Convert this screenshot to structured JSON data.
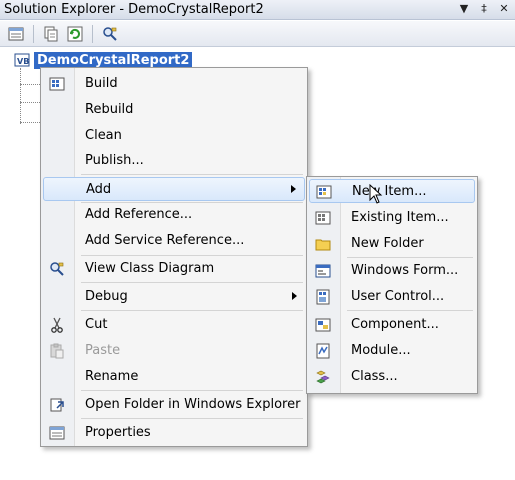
{
  "window": {
    "title": "Solution Explorer - DemoCrystalReport2",
    "buttons": [
      "▼",
      "‡",
      "✕"
    ]
  },
  "toolbar": {
    "icons": [
      "properties-icon",
      "show-all-files-icon",
      "refresh-icon",
      "view-class-diagram-icon"
    ]
  },
  "tree": {
    "root_label": "DemoCrystalReport2"
  },
  "context_menu": {
    "items": [
      {
        "label": "Build",
        "icon": "build-icon"
      },
      {
        "label": "Rebuild",
        "icon": ""
      },
      {
        "label": "Clean",
        "icon": ""
      },
      {
        "label": "Publish...",
        "icon": ""
      },
      {
        "label": "Add",
        "icon": "",
        "submenu": true,
        "highlighted": true
      },
      {
        "label": "Add Reference...",
        "icon": ""
      },
      {
        "label": "Add Service Reference...",
        "icon": ""
      },
      {
        "label": "View Class Diagram",
        "icon": "class-diagram-icon"
      },
      {
        "label": "Debug",
        "icon": "",
        "submenu": true
      },
      {
        "label": "Cut",
        "icon": "scissors-icon"
      },
      {
        "label": "Paste",
        "icon": "paste-icon",
        "disabled": true
      },
      {
        "label": "Rename",
        "icon": ""
      },
      {
        "label": "Open Folder in Windows Explorer",
        "icon": "open-folder-icon"
      },
      {
        "label": "Properties",
        "icon": "properties-icon"
      }
    ]
  },
  "add_submenu": {
    "items": [
      {
        "label": "New Item...",
        "icon": "new-item-icon",
        "highlighted": true
      },
      {
        "label": "Existing Item...",
        "icon": "existing-item-icon"
      },
      {
        "label": "New Folder",
        "icon": "folder-icon"
      },
      {
        "label": "Windows Form...",
        "icon": "windows-form-icon"
      },
      {
        "label": "User Control...",
        "icon": "user-control-icon"
      },
      {
        "label": "Component...",
        "icon": "component-icon"
      },
      {
        "label": "Module...",
        "icon": "module-icon"
      },
      {
        "label": "Class...",
        "icon": "class-icon"
      }
    ]
  },
  "colors": {
    "selection": "#3169c6",
    "highlight_border": "#a8c8f0"
  }
}
